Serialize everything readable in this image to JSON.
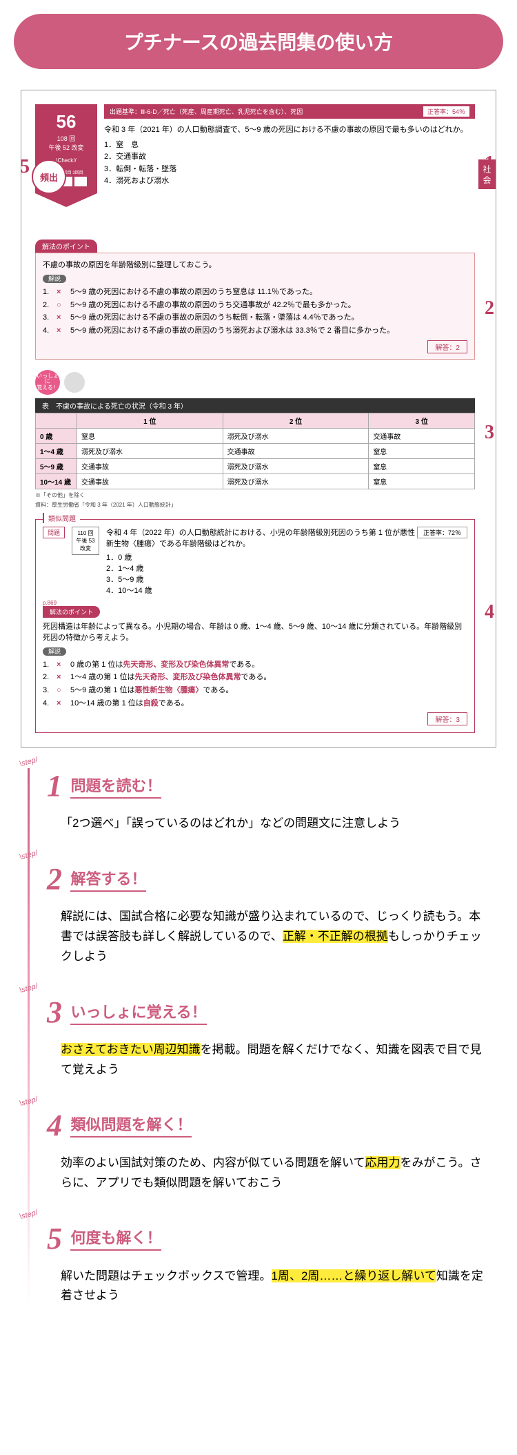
{
  "title": "プチナースの過去問集の使い方",
  "example": {
    "qnum": "56",
    "source": "108 回\n午後 52 改変",
    "check_label": "\\Check!/",
    "check_sub": "1回目 2回目 3回目",
    "freq_badge": "頻出",
    "criteria_label": "出題基準",
    "criteria_text": "：Ⅲ-6-D／死亡（死産、周産期死亡、乳児死亡を含む）、死因",
    "correct_rate_label": "正答率：54％",
    "question": "令和 3 年（2021 年）の人口動態調査で、5〜9 歳の死因における不慮の事故の原因で最も多いのはどれか。",
    "options": [
      "1．窒　息",
      "2．交通事故",
      "3．転倒・転落・墜落",
      "4．溺死および溺水"
    ],
    "side_tab": "社 会",
    "point_header": "解法のポイント",
    "point_text": "不慮の事故の原因を年齢階級別に整理しておこう。",
    "explain_label": "解説",
    "explanations": [
      {
        "idx": "1.",
        "mark": "×",
        "text": "5〜9 歳の死因における不慮の事故の原因のうち窒息は 11.1％であった。"
      },
      {
        "idx": "2.",
        "mark": "○",
        "text": "5〜9 歳の死因における不慮の事故の原因のうち交通事故が 42.2％で最も多かった。"
      },
      {
        "idx": "3.",
        "mark": "×",
        "text": "5〜9 歳の死因における不慮の事故の原因のうち転倒・転落・墜落は 4.4％であった。"
      },
      {
        "idx": "4.",
        "mark": "×",
        "text": "5〜9 歳の死因における不慮の事故の原因のうち溺死および溺水は 33.3％で 2 番目に多かった。"
      }
    ],
    "answer_label": "解答：2",
    "together_label": "いっしょに\n覚える！",
    "table_title": "表　不慮の事故による死亡の状況（令和 3 年）",
    "table": {
      "headers": [
        "",
        "1 位",
        "2 位",
        "3 位"
      ],
      "rows": [
        [
          "0 歳",
          "窒息",
          "溺死及び溺水",
          "交通事故"
        ],
        [
          "1〜4 歳",
          "溺死及び溺水",
          "交通事故",
          "窒息"
        ],
        [
          "5〜9 歳",
          "交通事故",
          "溺死及び溺水",
          "窒息"
        ],
        [
          "10〜14 歳",
          "交通事故",
          "溺死及び溺水",
          "窒息"
        ]
      ],
      "note1": "※「その他」を除く",
      "note2": "資料：厚生労働省「令和 3 年（2021 年）人口動態統計」"
    },
    "similar": {
      "tab": "類似問題",
      "rate": "正答率：72％",
      "q_label": "問題",
      "src": "110 回\n午後 53\n改変",
      "question": "令和 4 年（2022 年）の人口動態統計における、小児の年齢階級別死因のうち第 1 位が悪性新生物〈腫瘍〉である年齢階級はどれか。",
      "options": [
        "1．0 歳",
        "2．1〜4 歳",
        "3．5〜9 歳",
        "4．10〜14 歳"
      ],
      "pref": "p.869",
      "pt_header": "解法のポイント",
      "pt_text": "死因構造は年齢によって異なる。小児期の場合、年齢は 0 歳、1〜4 歳、5〜9 歳、10〜14 歳に分類されている。年齢階級別死因の特徴から考えよう。",
      "explain_label": "解説",
      "explanations": [
        {
          "idx": "1.",
          "mark": "×",
          "pre": "0 歳の第 1 位は",
          "hl": "先天奇形、変形及び染色体異常",
          "post": "である。"
        },
        {
          "idx": "2.",
          "mark": "×",
          "pre": "1〜4 歳の第 1 位は",
          "hl": "先天奇形、変形及び染色体異常",
          "post": "である。"
        },
        {
          "idx": "3.",
          "mark": "○",
          "pre": "5〜9 歳の第 1 位は",
          "hl": "悪性新生物〈腫瘍〉",
          "post": "である。"
        },
        {
          "idx": "4.",
          "mark": "×",
          "pre": "10〜14 歳の第 1 位は",
          "hl": "自殺",
          "post": "である。"
        }
      ],
      "answer_label": "解答：3"
    },
    "callouts": {
      "c1": "1",
      "c2": "2",
      "c3": "3",
      "c4": "4",
      "c5": "5"
    }
  },
  "steps": [
    {
      "num": "1",
      "title": "問題を読む！",
      "body": [
        {
          "t": "「2つ選べ」「誤っているのはどれか」などの問題文に注意しよう"
        }
      ]
    },
    {
      "num": "2",
      "title": "解答する！",
      "body": [
        {
          "t": "解説には、国試合格に必要な知識が盛り込まれているので、じっくり読もう。本書では誤答肢も詳しく解説しているので、"
        },
        {
          "t": "正解・不正解の根拠",
          "hl": true
        },
        {
          "t": "もしっかりチェックしよう"
        }
      ]
    },
    {
      "num": "3",
      "title": "いっしょに覚える！",
      "body": [
        {
          "t": "おさえておきたい周辺知識",
          "hl": true
        },
        {
          "t": "を掲載。問題を解くだけでなく、知識を図表で目で見て覚えよう"
        }
      ]
    },
    {
      "num": "4",
      "title": "類似問題を解く！",
      "body": [
        {
          "t": "効率のよい国試対策のため、内容が似ている問題を解いて"
        },
        {
          "t": "応用力",
          "hl": true
        },
        {
          "t": "をみがこう。さらに、アプリでも類似問題を解いておこう"
        }
      ]
    },
    {
      "num": "5",
      "title": "何度も解く！",
      "body": [
        {
          "t": "解いた問題はチェックボックスで管理。"
        },
        {
          "t": "1周、2周……と繰り返し解いて",
          "hl": true
        },
        {
          "t": "知識を定着させよう"
        }
      ]
    }
  ],
  "step_label": "\\step/"
}
